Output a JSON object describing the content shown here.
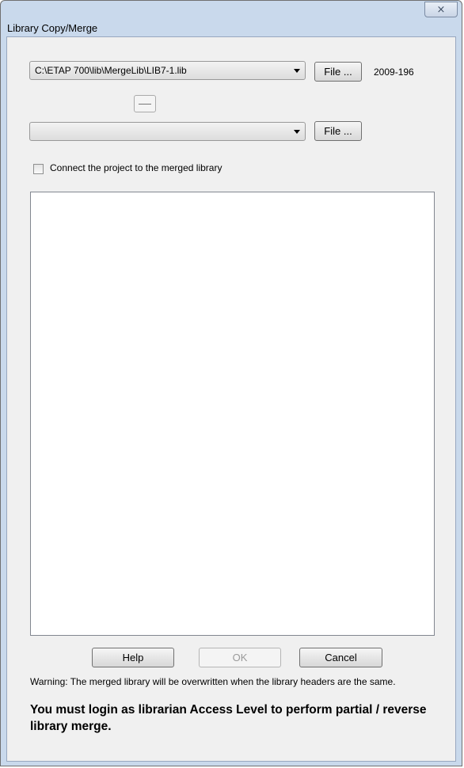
{
  "window": {
    "title": "Library Copy/Merge",
    "close_glyph": "⨯"
  },
  "source": {
    "path": "C:\\ETAP 700\\lib\\MergeLib\\LIB7-1.lib",
    "file_button": "File ...",
    "version": "2009-196"
  },
  "target": {
    "path": "",
    "file_button": "File ..."
  },
  "connect_checkbox": {
    "label": "Connect the project to the merged library",
    "checked": false
  },
  "buttons": {
    "help": "Help",
    "ok": "OK",
    "cancel": "Cancel"
  },
  "messages": {
    "warning": "Warning: The merged library will be overwritten when the library headers are the same.",
    "access": "You must login as librarian Access Level to perform partial / reverse library merge."
  }
}
